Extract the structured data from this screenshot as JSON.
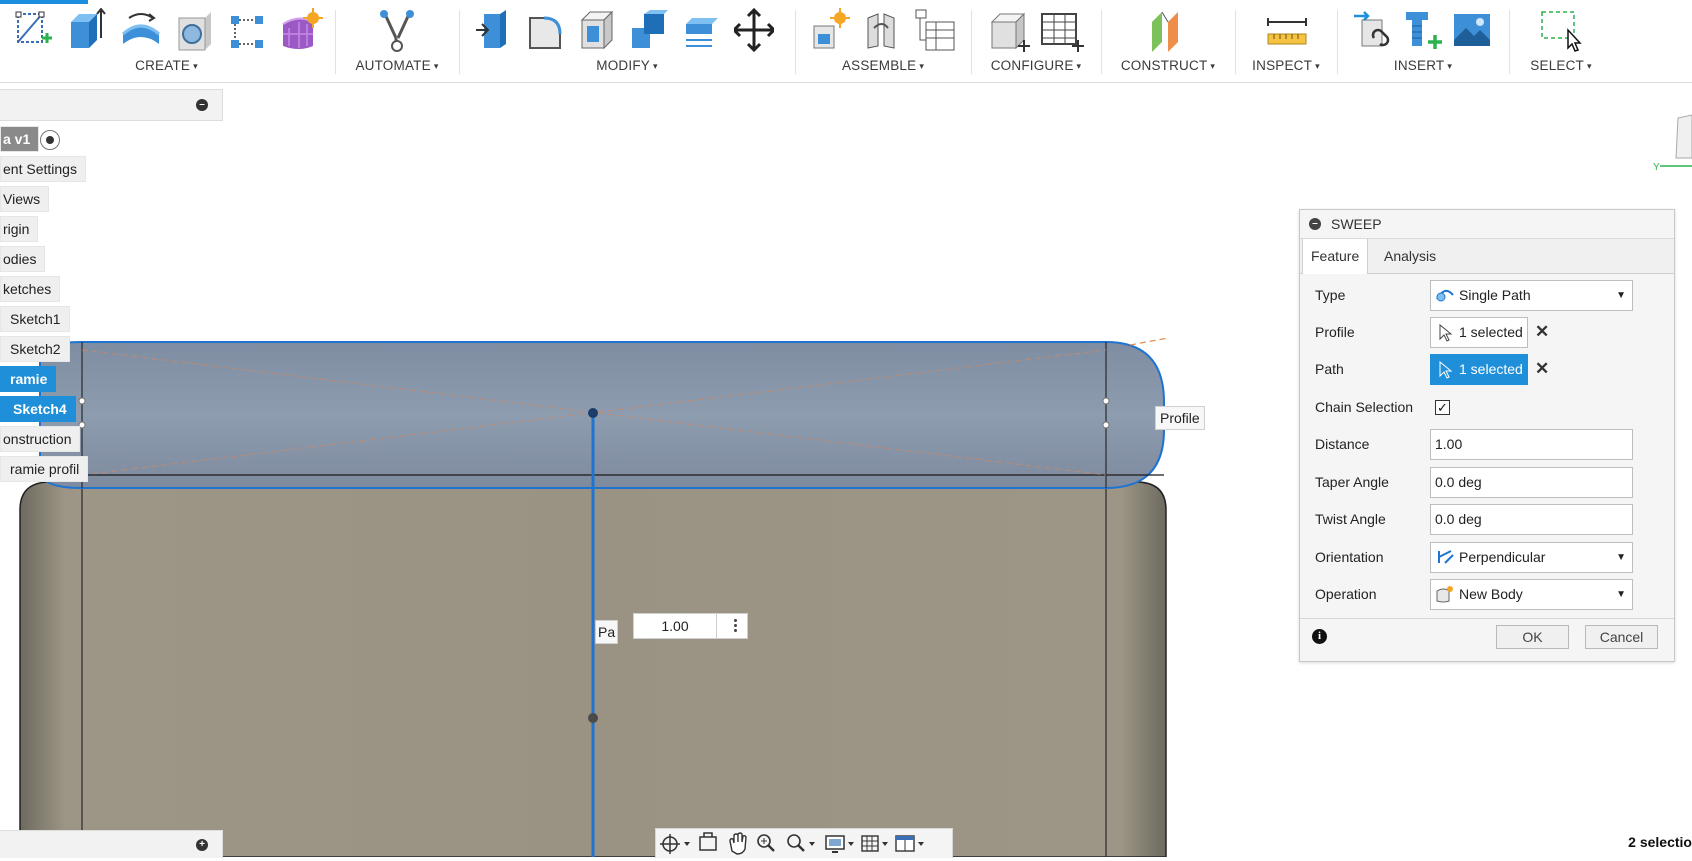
{
  "toolbar": {
    "groups": [
      {
        "label": "CREATE"
      },
      {
        "label": "AUTOMATE"
      },
      {
        "label": "MODIFY"
      },
      {
        "label": "ASSEMBLE"
      },
      {
        "label": "CONFIGURE"
      },
      {
        "label": "CONSTRUCT"
      },
      {
        "label": "INSPECT"
      },
      {
        "label": "INSERT"
      },
      {
        "label": "SELECT"
      }
    ],
    "caret": "▾"
  },
  "browser": {
    "items": [
      {
        "label": "a v1"
      },
      {
        "label": "ent Settings"
      },
      {
        "label": "Views"
      },
      {
        "label": "rigin"
      },
      {
        "label": "odies"
      },
      {
        "label": "ketches"
      },
      {
        "label": "Sketch1"
      },
      {
        "label": "Sketch2"
      },
      {
        "label": "ramie"
      },
      {
        "label": "Sketch4"
      },
      {
        "label": "onstruction"
      },
      {
        "label": "ramie profil"
      }
    ]
  },
  "viewport": {
    "profile_tag": "Profile",
    "path_tag": "Pa",
    "dimension_value": "1.00"
  },
  "sweep": {
    "title": "SWEEP",
    "tabs": [
      "Feature",
      "Analysis"
    ],
    "rows": {
      "type": {
        "label": "Type",
        "value": "Single Path"
      },
      "profile": {
        "label": "Profile",
        "value": "1 selected"
      },
      "path": {
        "label": "Path",
        "value": "1 selected"
      },
      "chain": {
        "label": "Chain Selection",
        "checked": true
      },
      "distance": {
        "label": "Distance",
        "value": "1.00"
      },
      "taper": {
        "label": "Taper Angle",
        "value": "0.0 deg"
      },
      "twist": {
        "label": "Twist Angle",
        "value": "0.0 deg"
      },
      "orientation": {
        "label": "Orientation",
        "value": "Perpendicular"
      },
      "operation": {
        "label": "Operation",
        "value": "New Body"
      }
    },
    "ok_label": "OK",
    "cancel_label": "Cancel",
    "clear_glyph": "✕",
    "check_glyph": "✓"
  },
  "status": {
    "text": "2 selectio"
  },
  "colors": {
    "accent": "#1e8fd8",
    "body": "#9a9384",
    "profile_fill": "#8898ad"
  }
}
